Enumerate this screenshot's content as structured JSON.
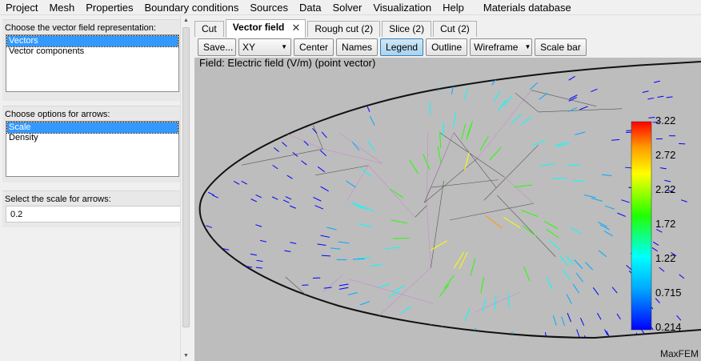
{
  "menu": [
    "Project",
    "Mesh",
    "Properties",
    "Boundary conditions",
    "Sources",
    "Data",
    "Solver",
    "Visualization",
    "Help",
    "Materials database"
  ],
  "left": {
    "rep_label": "Choose the vector field representation:",
    "rep_items": [
      {
        "label": "Vectors",
        "selected": true
      },
      {
        "label": "Vector components",
        "selected": false
      }
    ],
    "arrow_label": "Choose options for arrows:",
    "arrow_items": [
      {
        "label": "Scale",
        "selected": true
      },
      {
        "label": "Density",
        "selected": false
      }
    ],
    "scale_label": "Select the scale for arrows:",
    "scale_value": "0.2"
  },
  "tabs": [
    {
      "label": "Cut",
      "active": false
    },
    {
      "label": "Vector field",
      "active": true
    },
    {
      "label": "Rough cut (2)",
      "active": false
    },
    {
      "label": "Slice (2)",
      "active": false
    },
    {
      "label": "Cut (2)",
      "active": false
    }
  ],
  "toolbar": {
    "save": "Save...",
    "view": "XY view",
    "center": "Center",
    "names": "Names",
    "legend": "Legend",
    "outline": "Outline",
    "render_mode": "Wireframe",
    "scale_bar": "Scale bar"
  },
  "viewport": {
    "field_title": "Field: Electric field (V/m) (point vector)",
    "legend_values": [
      "3.22",
      "2.72",
      "2.22",
      "1.72",
      "1.22",
      "0.715",
      "0.214"
    ],
    "brand": "MaxFEM",
    "background": "#bdbdbd"
  }
}
